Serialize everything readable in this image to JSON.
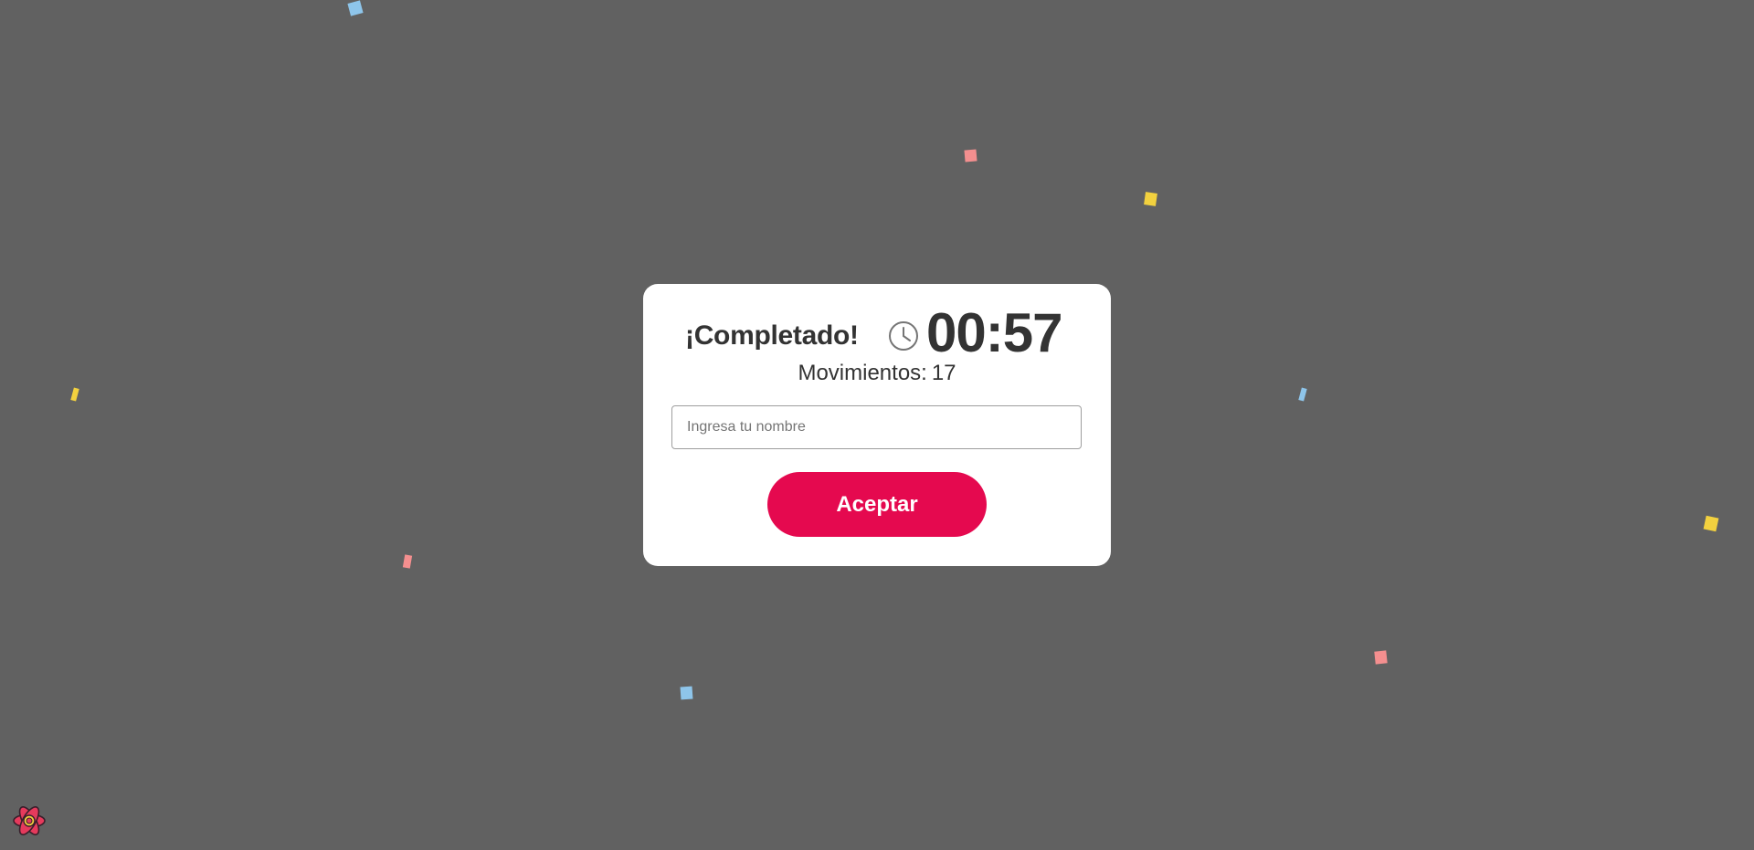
{
  "colors": {
    "background": "#616161",
    "card": "#ffffff",
    "text": "#333333",
    "accent": "#e5094f",
    "confetti_pink": "#f48f8f",
    "confetti_yellow": "#f2d13f",
    "confetti_blue": "#8ec5ea"
  },
  "modal": {
    "title": "¡Completado!",
    "clock_icon": "clock-icon",
    "timer": "00:57",
    "moves_label": "Movimientos:",
    "moves_value": "17",
    "name_input": {
      "value": "",
      "placeholder": "Ingresa tu nombre"
    },
    "accept_label": "Aceptar"
  },
  "corner_icon": "react-devtools-icon",
  "confetti": [
    {
      "color": "#8ec5ea"
    },
    {
      "color": "#f48f8f"
    },
    {
      "color": "#f2d13f"
    },
    {
      "color": "#f2d13f"
    },
    {
      "color": "#8ec5ea"
    },
    {
      "color": "#f2d13f"
    },
    {
      "color": "#f48f8f"
    },
    {
      "color": "#f48f8f"
    },
    {
      "color": "#8ec5ea"
    }
  ]
}
